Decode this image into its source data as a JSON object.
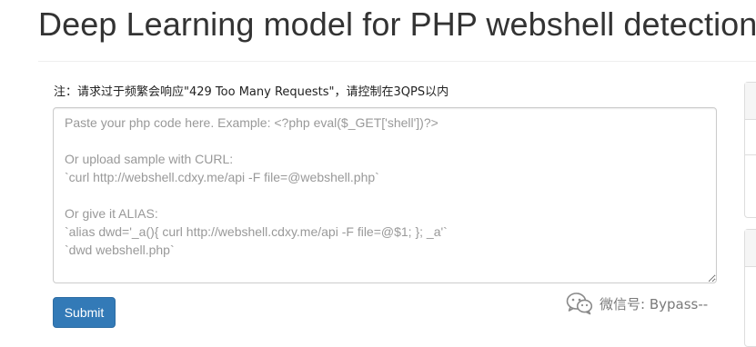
{
  "header": {
    "title": "Deep Learning model for PHP webshell detection"
  },
  "notice": {
    "text": "注：请求过于频繁会响应\"429 Too Many Requests\"，请控制在3QPS以内"
  },
  "code_input": {
    "value": "",
    "placeholder": "Paste your php code here. Example: <?php eval($_GET['shell'])?>\n\nOr upload sample with CURL:\n`curl http://webshell.cdxy.me/api -F file=@webshell.php`\n\nOr give it ALIAS:\n`alias dwd='_a(){ curl http://webshell.cdxy.me/api -F file=@$1; }; _a'`\n`dwd webshell.php`"
  },
  "actions": {
    "submit_label": "Submit"
  },
  "watermark": {
    "icon": "wechat-icon",
    "text": "微信号: Bypass--"
  },
  "colors": {
    "primary": "#337ab7",
    "text": "#333333",
    "placeholder": "#999999",
    "border": "#cccccc"
  }
}
